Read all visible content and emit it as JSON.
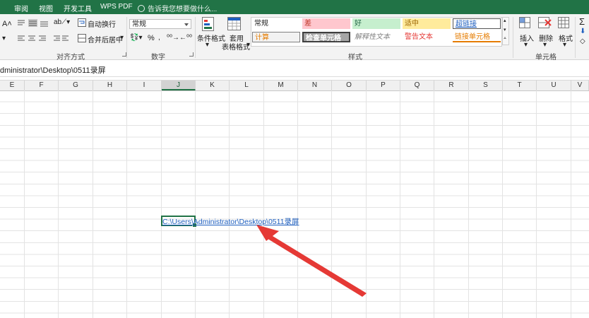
{
  "tabs": [
    "审阅",
    "视图",
    "开发工具",
    "WPS PDF"
  ],
  "tell_me": "告诉我您想要做什么...",
  "ribbon": {
    "alignment": {
      "wrap_text": "自动换行",
      "merge_center": "合并后居中",
      "group_label": "对齐方式"
    },
    "number": {
      "format": "常规",
      "percent": "%",
      "group_label": "数字"
    },
    "styles": {
      "conditional_format": "条件格式",
      "table_format_line1": "套用",
      "table_format_line2": "表格格式",
      "group_label": "样式",
      "items": [
        {
          "label": "常规",
          "color": "#222222",
          "bg": "#ffffff"
        },
        {
          "label": "差",
          "color": "#c0392b",
          "bg": "#ffc7ce"
        },
        {
          "label": "好",
          "color": "#276749",
          "bg": "#c6efce"
        },
        {
          "label": "适中",
          "color": "#9c6500",
          "bg": "#ffeb9c"
        },
        {
          "label": "超链接",
          "color": "#1f5fbf",
          "bg": "#ffffff"
        },
        {
          "label": "计算",
          "color": "#e57c00",
          "bg": "#f2f2f2"
        },
        {
          "label": "检查单元格",
          "color": "#ffffff",
          "bg": "#a5a5a5"
        },
        {
          "label": "解释性文本",
          "color": "#7f7f7f",
          "bg": "#ffffff"
        },
        {
          "label": "警告文本",
          "color": "#e53935",
          "bg": "#ffffff"
        },
        {
          "label": "链接单元格",
          "color": "#e57c00",
          "bg": "#ffffff"
        }
      ]
    },
    "cells": {
      "insert": "插入",
      "delete": "删除",
      "format": "格式",
      "group_label": "单元格"
    }
  },
  "formula_bar_value": "dministrator\\Desktop\\0511录屏",
  "columns": [
    "E",
    "F",
    "G",
    "H",
    "I",
    "J",
    "K",
    "L",
    "M",
    "N",
    "O",
    "P",
    "Q",
    "R",
    "S",
    "T",
    "U",
    "V"
  ],
  "selected_column": "J",
  "cell_content": "C:\\Users\\Administrator\\Desktop\\0511录屏",
  "colors": {
    "excel_green": "#217346",
    "hyperlink": "#1f5fbf",
    "arrow": "#e53935"
  }
}
